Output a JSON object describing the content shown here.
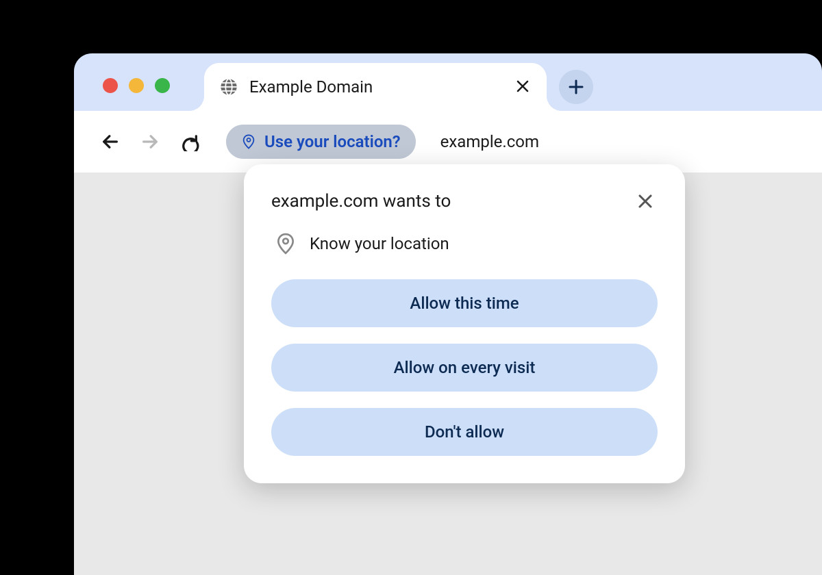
{
  "tab": {
    "title": "Example Domain"
  },
  "addressbar": {
    "chip_text": "Use your location?",
    "url": "example.com"
  },
  "dialog": {
    "title": "example.com wants to",
    "permission_text": "Know your location",
    "buttons": {
      "allow_once": "Allow this time",
      "allow_always": "Allow on every visit",
      "deny": "Don't allow"
    }
  }
}
